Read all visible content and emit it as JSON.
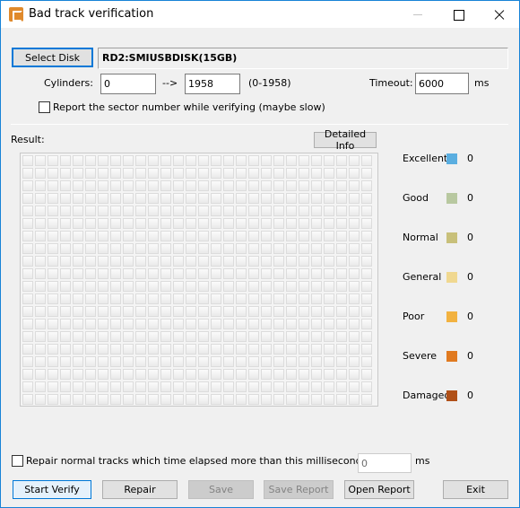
{
  "window": {
    "title": "Bad track verification",
    "controls": [
      "minimize",
      "maximize",
      "close"
    ]
  },
  "disk": {
    "select_label": "Select Disk",
    "name": "RD2:SMIUSBDISK(15GB)"
  },
  "cylinders": {
    "label": "Cylinders:",
    "from": "0",
    "arrow": "-->",
    "to": "1958",
    "range": "(0-1958)"
  },
  "timeout": {
    "label": "Timeout:",
    "value": "6000",
    "unit": "ms"
  },
  "report_sector": {
    "label": "Report the sector number while verifying (maybe slow)",
    "checked": false
  },
  "result": {
    "label": "Result:",
    "detailed_info_label": "Detailed Info",
    "grid_cols": 28,
    "grid_rows": 20
  },
  "legend": [
    {
      "label": "Excellent",
      "count": "0",
      "color": "#5aaee0"
    },
    {
      "label": "Good",
      "count": "0",
      "color": "#b8c8a0"
    },
    {
      "label": "Normal",
      "count": "0",
      "color": "#c8c07a"
    },
    {
      "label": "General",
      "count": "0",
      "color": "#f0d890"
    },
    {
      "label": "Poor",
      "count": "0",
      "color": "#f2b240"
    },
    {
      "label": "Severe",
      "count": "0",
      "color": "#e07a20"
    },
    {
      "label": "Damaged",
      "count": "0",
      "color": "#b05018"
    }
  ],
  "repair_option": {
    "label": "Repair normal tracks which time elapsed more than this millisecond(lossless):",
    "value": "0",
    "unit": "ms",
    "checked": false
  },
  "buttons": {
    "start_verify": "Start Verify",
    "repair": "Repair",
    "save": "Save",
    "save_report": "Save Report",
    "open_report": "Open Report",
    "exit": "Exit"
  }
}
